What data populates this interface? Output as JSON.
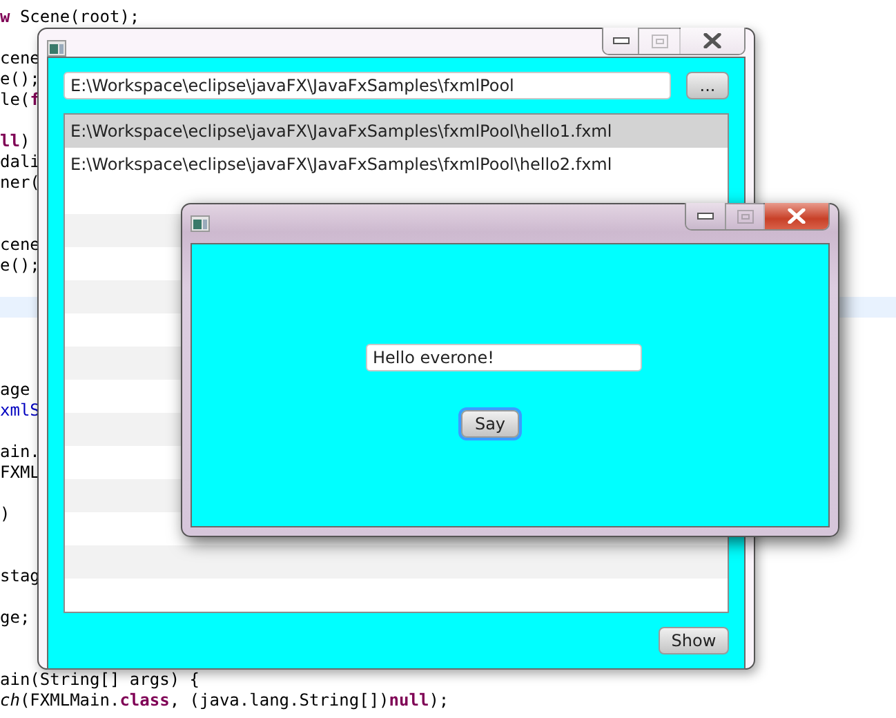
{
  "code_editor": {
    "lines": [
      {
        "kind": "code",
        "segments": [
          {
            "text": "w",
            "kind": "keyword"
          },
          {
            "text": " Scene(root);",
            "kind": "plain"
          }
        ]
      },
      {
        "kind": "blank"
      },
      {
        "kind": "code",
        "segments": [
          {
            "text": "cene",
            "kind": "plain"
          }
        ]
      },
      {
        "kind": "code",
        "segments": [
          {
            "text": "e();",
            "kind": "plain"
          }
        ]
      },
      {
        "kind": "code",
        "segments": [
          {
            "text": "le(",
            "kind": "plain"
          },
          {
            "text": "f",
            "kind": "keyword"
          }
        ]
      },
      {
        "kind": "blank"
      },
      {
        "kind": "code",
        "segments": [
          {
            "text": "ll",
            "kind": "keyword"
          },
          {
            "text": ")",
            "kind": "plain"
          }
        ]
      },
      {
        "kind": "code",
        "segments": [
          {
            "text": "dali",
            "kind": "plain"
          }
        ]
      },
      {
        "kind": "code",
        "segments": [
          {
            "text": "ner(",
            "kind": "plain"
          }
        ]
      },
      {
        "kind": "blank"
      },
      {
        "kind": "blank"
      },
      {
        "kind": "code",
        "segments": [
          {
            "text": "cene",
            "kind": "plain"
          }
        ]
      },
      {
        "kind": "code",
        "segments": [
          {
            "text": "e();",
            "kind": "plain"
          }
        ]
      },
      {
        "kind": "blank"
      },
      {
        "kind": "current"
      },
      {
        "kind": "blank"
      },
      {
        "kind": "blank"
      },
      {
        "kind": "blank"
      },
      {
        "kind": "code",
        "segments": [
          {
            "text": "age",
            "kind": "plain"
          }
        ]
      },
      {
        "kind": "code",
        "segments": [
          {
            "text": "xmlS",
            "kind": "field"
          }
        ]
      },
      {
        "kind": "blank"
      },
      {
        "kind": "code",
        "segments": [
          {
            "text": "ain.",
            "kind": "plain"
          }
        ]
      },
      {
        "kind": "code",
        "segments": [
          {
            "text": "FXML",
            "kind": "plain"
          }
        ]
      },
      {
        "kind": "blank"
      },
      {
        "kind": "code",
        "segments": [
          {
            "text": ")",
            "kind": "plain"
          }
        ]
      },
      {
        "kind": "blank"
      },
      {
        "kind": "blank"
      },
      {
        "kind": "code",
        "segments": [
          {
            "text": "stag",
            "kind": "plain"
          }
        ]
      },
      {
        "kind": "blank"
      },
      {
        "kind": "code",
        "segments": [
          {
            "text": "ge;",
            "kind": "plain"
          }
        ]
      },
      {
        "kind": "blank"
      },
      {
        "kind": "blank"
      },
      {
        "kind": "code",
        "segments": [
          {
            "text": "ain(String[] args) {",
            "kind": "plain"
          }
        ]
      },
      {
        "kind": "code",
        "segments": [
          {
            "text": "ch",
            "kind": "static"
          },
          {
            "text": "(FXMLMain.",
            "kind": "plain"
          },
          {
            "text": "class",
            "kind": "keyword"
          },
          {
            "text": ", (java.lang.String[])",
            "kind": "plain"
          },
          {
            "text": "null",
            "kind": "keyword"
          },
          {
            "text": ");",
            "kind": "plain"
          }
        ]
      }
    ]
  },
  "main_window": {
    "active": false,
    "maximize_disabled": true,
    "path_field": {
      "value": "E:\\Workspace\\eclipse\\javaFX\\JavaFxSamples\\fxmlPool"
    },
    "browse_button": "...",
    "files": [
      {
        "text": "E:\\Workspace\\eclipse\\javaFX\\JavaFxSamples\\fxmlPool\\hello1.fxml",
        "selected": true
      },
      {
        "text": "E:\\Workspace\\eclipse\\javaFX\\JavaFxSamples\\fxmlPool\\hello2.fxml",
        "selected": false
      }
    ],
    "show_button": "Show"
  },
  "dialog": {
    "active": true,
    "maximize_disabled": true,
    "message_field": {
      "value": "Hello everone!"
    },
    "say_button": {
      "label": "Say",
      "focused": true
    }
  }
}
